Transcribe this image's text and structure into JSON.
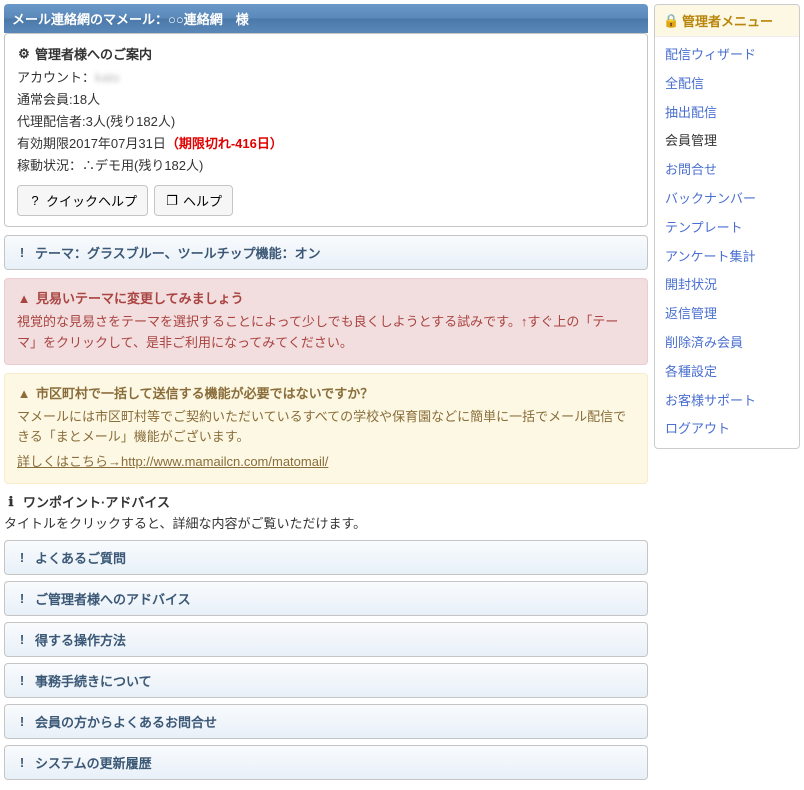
{
  "header": {
    "title": "メール連絡網のマメール：○○連絡網　様"
  },
  "info": {
    "heading": "管理者様へのご案内",
    "account_label": "アカウント：",
    "account_value": "kato",
    "members": "通常会員:18人",
    "proxy": "代理配信者:3人(残り182人)",
    "expire_prefix": "有効期限2017年07月31日",
    "expire_note": "（期限切れ-416日）",
    "status": "稼動状況：∴デモ用(残り182人)"
  },
  "buttons": {
    "quick": "クイックヘルプ",
    "help": "ヘルプ"
  },
  "theme_strip": "テーマ：グラスブルー、ツールチップ機能：オン",
  "alert1": {
    "title": "見易いテーマに変更してみましょう",
    "body": "視覚的な見易さをテーマを選択することによって少しでも良くしようとする試みです。↑すぐ上の「テーマ」をクリックして、是非ご利用になってみてください。"
  },
  "alert2": {
    "title": "市区町村で一括して送信する機能が必要ではないですか？",
    "body": "マメールには市区町村等でご契約いただいているすべての学校や保育園などに簡単に一括でメール配信できる「まとメール」機能がございます。",
    "link_label": "詳しくはこちら→http://www.mamailcn.com/matomail/"
  },
  "advice": {
    "title": "ワンポイント·アドバイス",
    "sub": "タイトルをクリックすると、詳細な内容がご覧いただけます。",
    "items": [
      "よくあるご質問",
      "ご管理者様へのアドバイス",
      "得する操作方法",
      "事務手続きについて",
      "会員の方からよくあるお問合せ",
      "システムの更新履歴"
    ]
  },
  "sidebar": {
    "title": "管理者メニュー",
    "items": [
      {
        "label": "配信ウィザード",
        "current": false
      },
      {
        "label": "全配信",
        "current": false
      },
      {
        "label": "抽出配信",
        "current": false
      },
      {
        "label": "会員管理",
        "current": true
      },
      {
        "label": "お問合せ",
        "current": false
      },
      {
        "label": "バックナンバー",
        "current": false
      },
      {
        "label": "テンプレート",
        "current": false
      },
      {
        "label": "アンケート集計",
        "current": false
      },
      {
        "label": "開封状況",
        "current": false
      },
      {
        "label": "返信管理",
        "current": false
      },
      {
        "label": "削除済み会員",
        "current": false
      },
      {
        "label": "各種設定",
        "current": false
      },
      {
        "label": "お客様サポート",
        "current": false
      },
      {
        "label": "ログアウト",
        "current": false
      }
    ]
  },
  "icons": {
    "gear": "⚙",
    "bang": "!",
    "warn": "▲",
    "info": "ℹ",
    "question": "?",
    "popup": "❐",
    "lock": "🔒"
  }
}
